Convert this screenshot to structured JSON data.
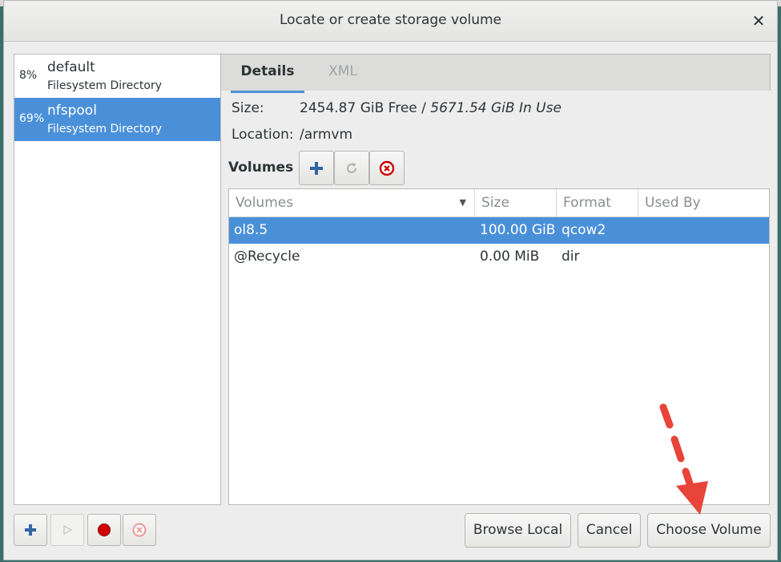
{
  "dialog": {
    "title": "Locate or create storage volume",
    "close_glyph": "✕"
  },
  "pools": [
    {
      "percent": "8%",
      "name": "default",
      "type": "Filesystem Directory",
      "selected": false
    },
    {
      "percent": "69%",
      "name": "nfspool",
      "type": "Filesystem Directory",
      "selected": true
    }
  ],
  "tabs": [
    {
      "label": "Details",
      "active": true
    },
    {
      "label": "XML",
      "active": false
    }
  ],
  "details": {
    "size_label": "Size:",
    "size_free": "2454.87 GiB Free",
    "size_sep": " / ",
    "size_used": "5671.54 GiB In Use",
    "location_label": "Location:",
    "location_value": "/armvm",
    "volumes_label": "Volumes"
  },
  "volume_toolbar": [
    {
      "icon": "add-icon"
    },
    {
      "icon": "refresh-icon"
    },
    {
      "icon": "delete-icon"
    }
  ],
  "volume_table": {
    "columns": [
      "Volumes",
      "Size",
      "Format",
      "Used By"
    ],
    "rows": [
      {
        "name": "ol8.5",
        "size": "100.00 GiB",
        "format": "qcow2",
        "used_by": "",
        "selected": true
      },
      {
        "name": "@Recycle",
        "size": "0.00 MiB",
        "format": "dir",
        "used_by": "",
        "selected": false
      }
    ]
  },
  "pool_toolbar": [
    {
      "icon": "add-icon",
      "enabled": true
    },
    {
      "icon": "play-icon",
      "enabled": false
    },
    {
      "icon": "stop-record-icon",
      "enabled": true
    },
    {
      "icon": "delete-icon",
      "enabled": true
    }
  ],
  "buttons": {
    "browse_local": "Browse Local",
    "cancel": "Cancel",
    "choose_volume": "Choose Volume"
  },
  "colors": {
    "selection": "#4a90d9",
    "annotation_arrow": "#e8443a"
  }
}
